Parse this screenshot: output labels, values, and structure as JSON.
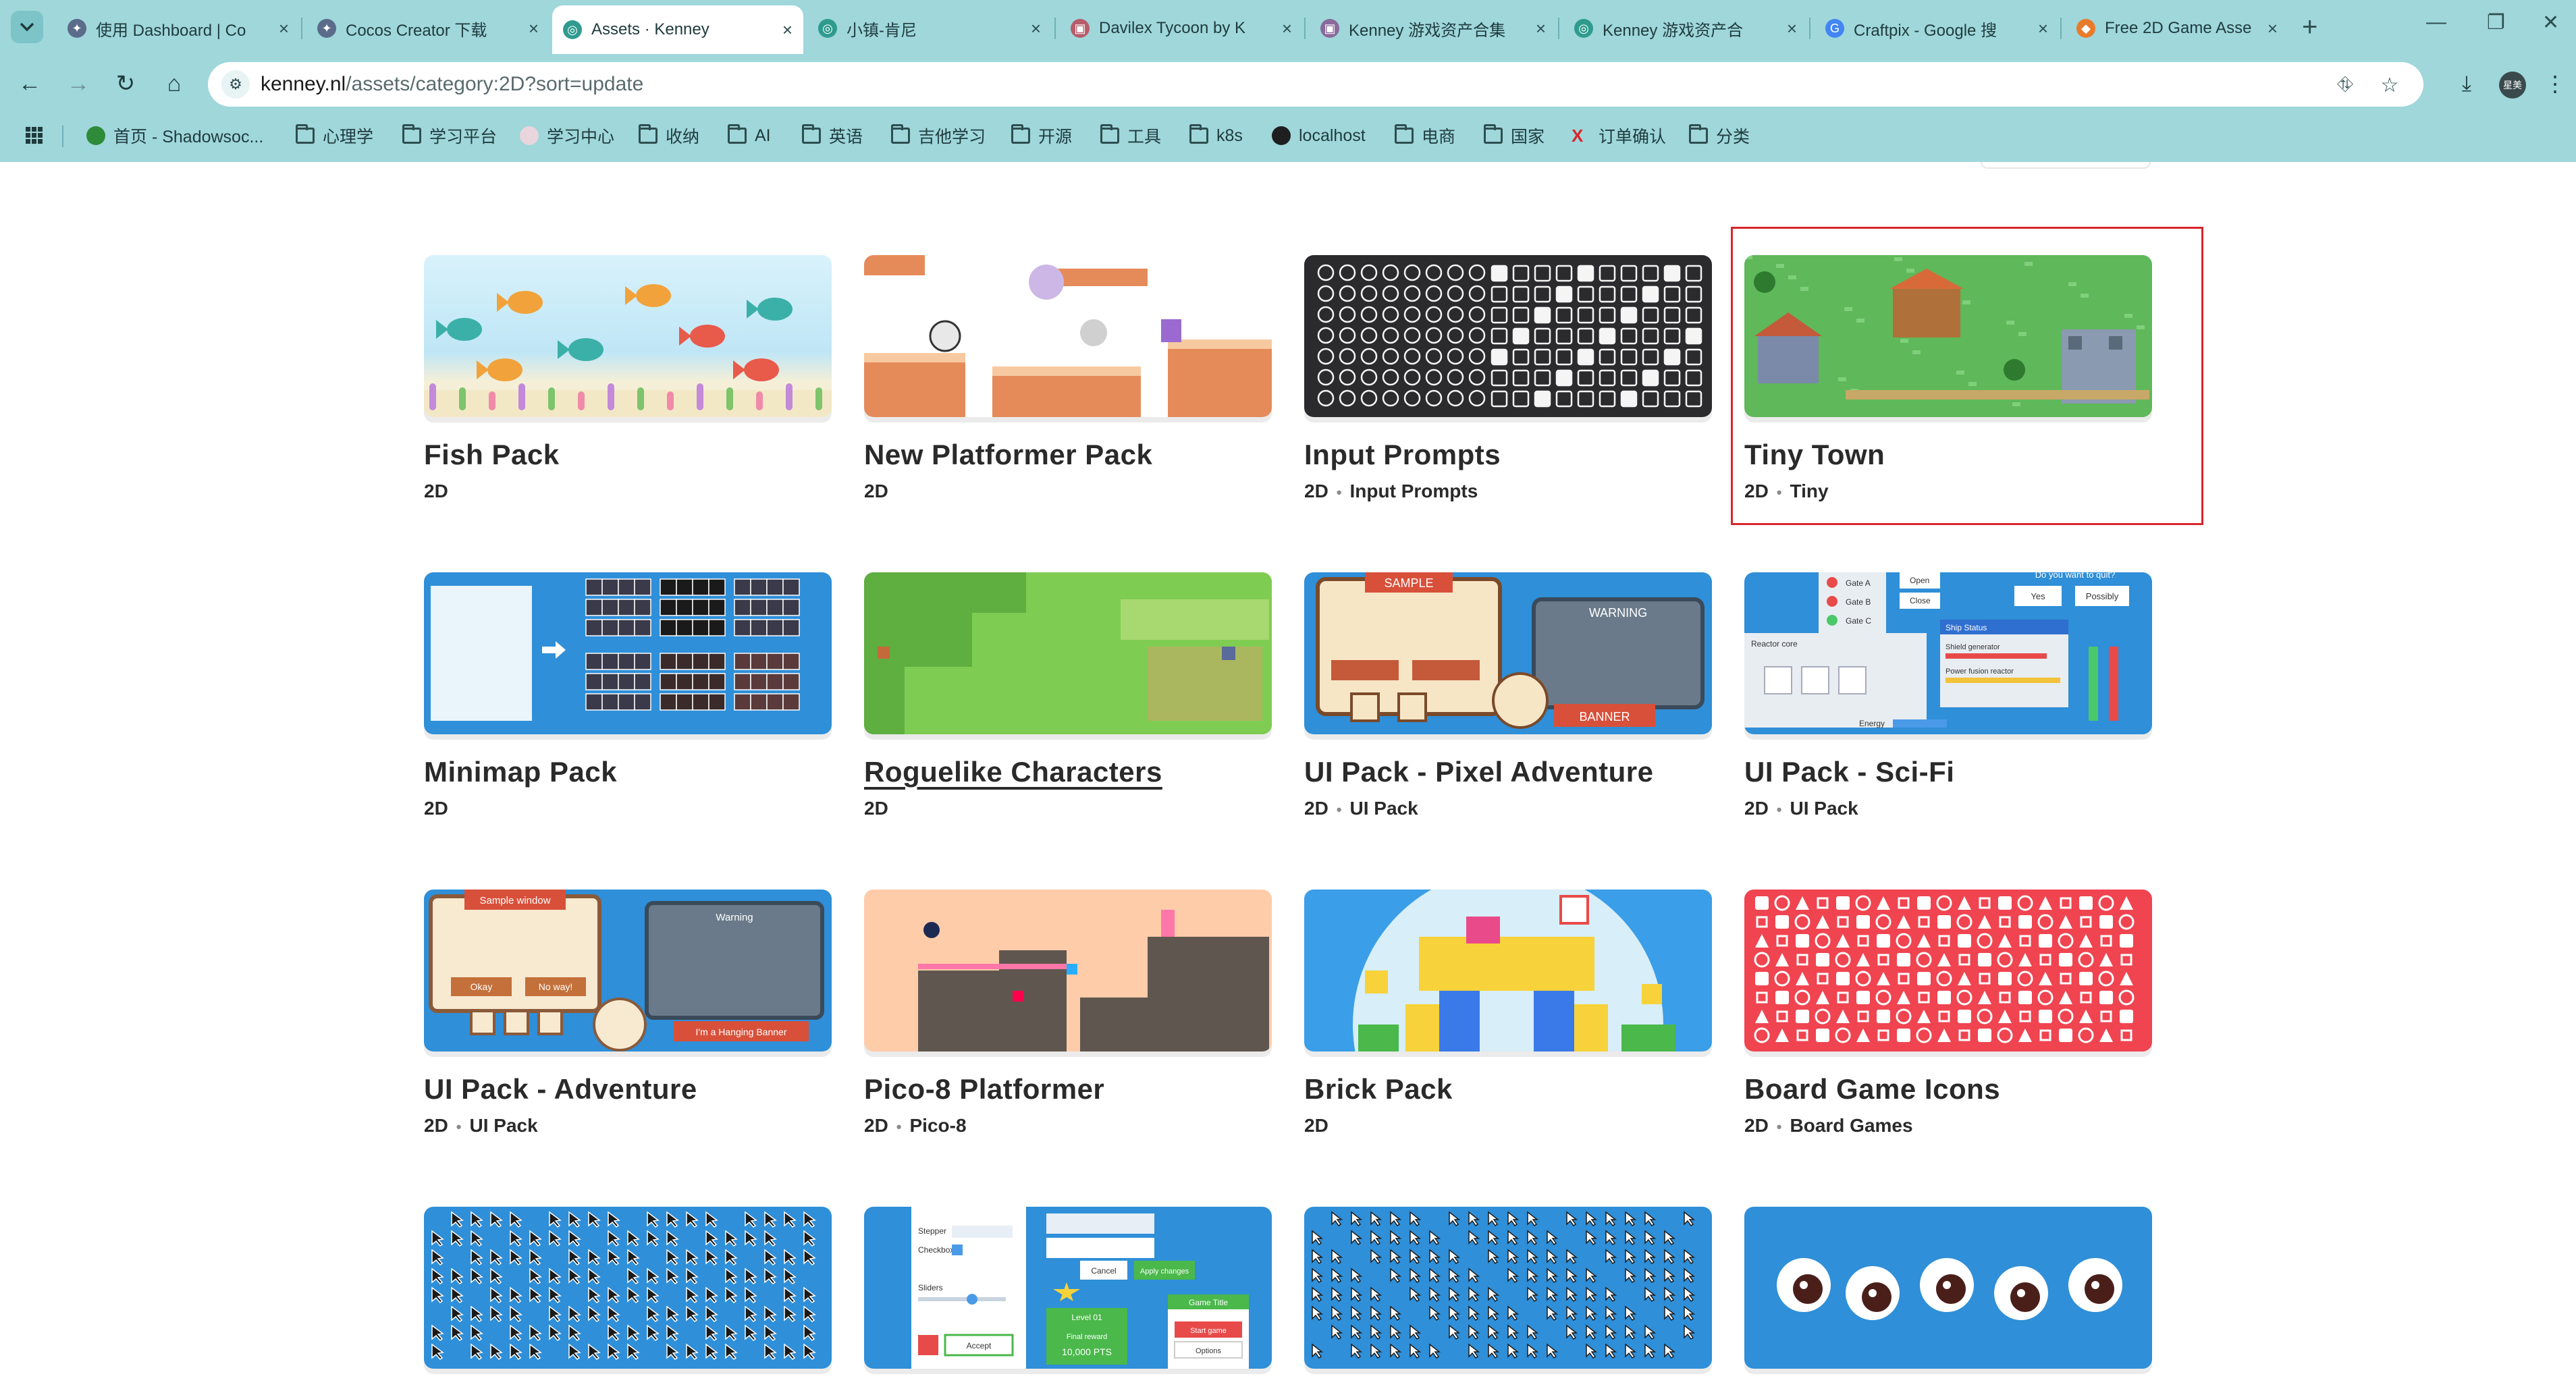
{
  "browser": {
    "tabs": [
      {
        "title": "使用 Dashboard | Co",
        "favicon_color": "#5b6b8a"
      },
      {
        "title": "Cocos Creator 下载",
        "favicon_color": "#5b6b8a"
      },
      {
        "title": "Assets · Kenney",
        "favicon_color": "#2f9b8f",
        "active": true
      },
      {
        "title": "小镇-肯尼",
        "favicon_color": "#2f9b8f"
      },
      {
        "title": "Davilex Tycoon by K",
        "favicon_color": "#b85c6a"
      },
      {
        "title": "Kenney 游戏资产合集",
        "favicon_color": "#8a6a9a"
      },
      {
        "title": "Kenney 游戏资产合",
        "favicon_color": "#2f9b8f"
      },
      {
        "title": "Craftpix - Google 搜",
        "favicon_color": "#4285f4"
      },
      {
        "title": "Free 2D Game Asse",
        "favicon_color": "#e87b2a"
      }
    ],
    "url_host": "kenney.nl",
    "url_path": "/assets/category:2D?sort=update",
    "profile_label": "星美",
    "bookmarks": [
      {
        "label": "首页 - Shadowsoc...",
        "icon": "green-circle-icon"
      },
      {
        "label": "心理学",
        "icon": "folder-icon"
      },
      {
        "label": "学习平台",
        "icon": "folder-icon"
      },
      {
        "label": "学习中心",
        "icon": "pin-icon"
      },
      {
        "label": "收纳",
        "icon": "folder-icon"
      },
      {
        "label": "AI",
        "icon": "folder-icon"
      },
      {
        "label": "英语",
        "icon": "folder-icon"
      },
      {
        "label": "吉他学习",
        "icon": "folder-icon"
      },
      {
        "label": "开源",
        "icon": "folder-icon"
      },
      {
        "label": "工具",
        "icon": "folder-icon"
      },
      {
        "label": "k8s",
        "icon": "folder-icon"
      },
      {
        "label": "localhost",
        "icon": "github-icon"
      },
      {
        "label": "电商",
        "icon": "folder-icon"
      },
      {
        "label": "国家",
        "icon": "folder-icon"
      },
      {
        "label": "订单确认",
        "icon": "red-x-icon"
      },
      {
        "label": "分类",
        "icon": "folder-icon"
      }
    ]
  },
  "assets": [
    {
      "title": "Fish Pack",
      "tags": [
        "2D"
      ]
    },
    {
      "title": "New Platformer Pack",
      "tags": [
        "2D"
      ]
    },
    {
      "title": "Input Prompts",
      "tags": [
        "2D",
        "Input Prompts"
      ]
    },
    {
      "title": "Tiny Town",
      "tags": [
        "2D",
        "Tiny"
      ]
    },
    {
      "title": "Minimap Pack",
      "tags": [
        "2D"
      ]
    },
    {
      "title": "Roguelike Characters",
      "tags": [
        "2D"
      ]
    },
    {
      "title": "UI Pack - Pixel Adventure",
      "tags": [
        "2D",
        "UI Pack"
      ]
    },
    {
      "title": "UI Pack - Sci-Fi",
      "tags": [
        "2D",
        "UI Pack"
      ]
    },
    {
      "title": "UI Pack - Adventure",
      "tags": [
        "2D",
        "UI Pack"
      ]
    },
    {
      "title": "Pico-8 Platformer",
      "tags": [
        "2D",
        "Pico-8"
      ]
    },
    {
      "title": "Brick Pack",
      "tags": [
        "2D"
      ]
    },
    {
      "title": "Board Game Icons",
      "tags": [
        "2D",
        "Board Games"
      ]
    }
  ],
  "thumb_text": {
    "pixel_sample": "SAMPLE",
    "pixel_warning": "WARNING",
    "pixel_banner": "BANNER",
    "scifi_gate_a": "Gate A",
    "scifi_gate_b": "Gate B",
    "scifi_gate_c": "Gate C",
    "scifi_open": "Open",
    "scifi_close": "Close",
    "scifi_quit": "Do you want to quit?",
    "scifi_yes": "Yes",
    "scifi_possibly": "Possibly",
    "scifi_ship_status": "Ship Status",
    "scifi_shield": "Shield generator",
    "scifi_power": "Power fusion reactor",
    "scifi_reactor": "Reactor core",
    "scifi_energy": "Energy",
    "adv_sample": "Sample window",
    "adv_warning": "Warning",
    "adv_okay": "Okay",
    "adv_nope": "No way!",
    "adv_hanging": "I'm a Hanging Banner",
    "ui_stepper": "Stepper",
    "ui_checkbox": "Checkbox",
    "ui_sliders": "Sliders",
    "ui_accept": "Accept",
    "ui_level": "Level 01",
    "ui_final_reward": "Final reward",
    "ui_points": "10,000 PTS",
    "ui_game_title": "Game Title",
    "ui_start_game": "Start game",
    "ui_options": "Options",
    "ui_apply": "Apply changes",
    "ui_cancel": "Cancel"
  }
}
